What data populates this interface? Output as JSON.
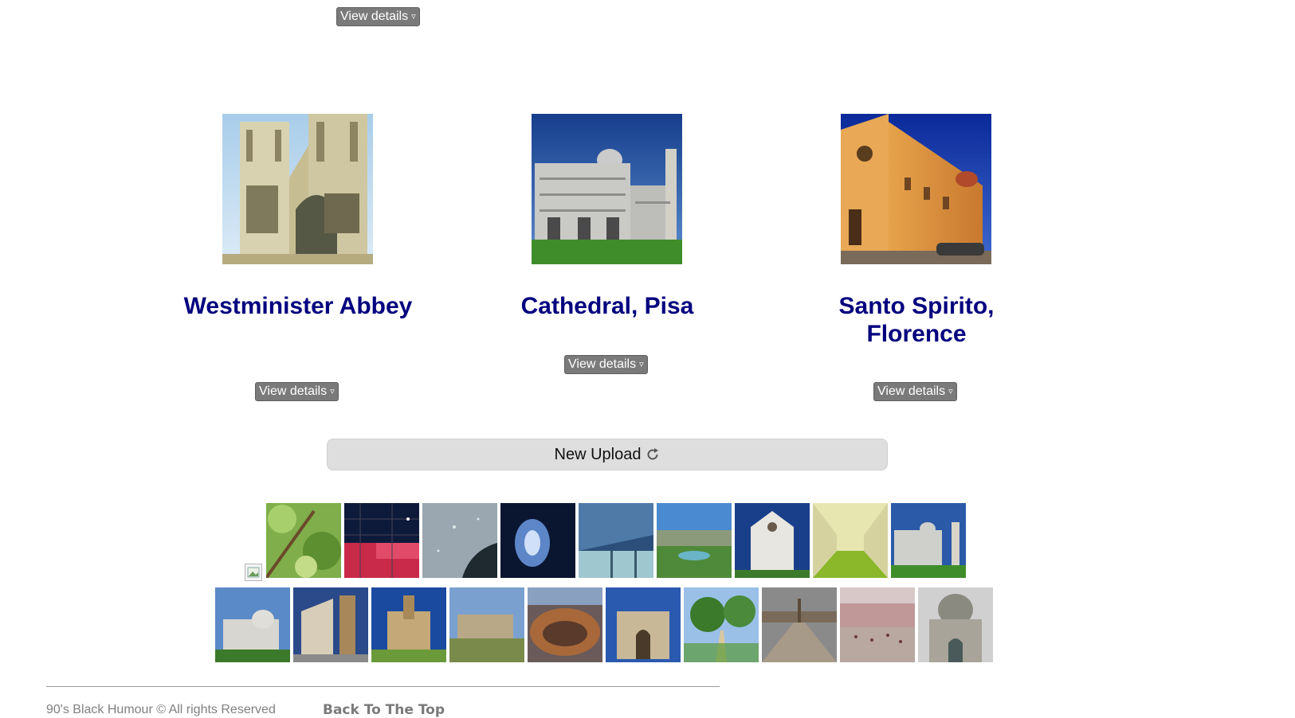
{
  "top": {
    "details_label": "View details",
    "details_arrow": "▿"
  },
  "cards": [
    {
      "title": "Westminister Abbey",
      "details_label": "View details",
      "details_arrow": "▿"
    },
    {
      "title": "Cathedral, Pisa",
      "details_label": "View details",
      "details_arrow": "▿"
    },
    {
      "title": "Santo Spirito, Florence",
      "details_label": "View details",
      "details_arrow": "▿"
    }
  ],
  "upload": {
    "label": "New Upload",
    "icon": "refresh-icon"
  },
  "gallery": {
    "row1": [
      "leaves",
      "red-grid",
      "grey-splash",
      "blue-light",
      "blue-window",
      "garden-view",
      "church-facade",
      "cloister-lawn",
      "pisa-cathedral"
    ],
    "row2": [
      "pisa-aerial",
      "lucca-church",
      "siena-church",
      "roman-forum",
      "colosseum",
      "arch-of-titus",
      "tree-path",
      "st-peters-square",
      "piazza-crowd",
      "domed-church"
    ]
  },
  "footer": {
    "copyright": "90's Black Humour © All rights Reserved",
    "back_to_top": "Back To The Top"
  }
}
